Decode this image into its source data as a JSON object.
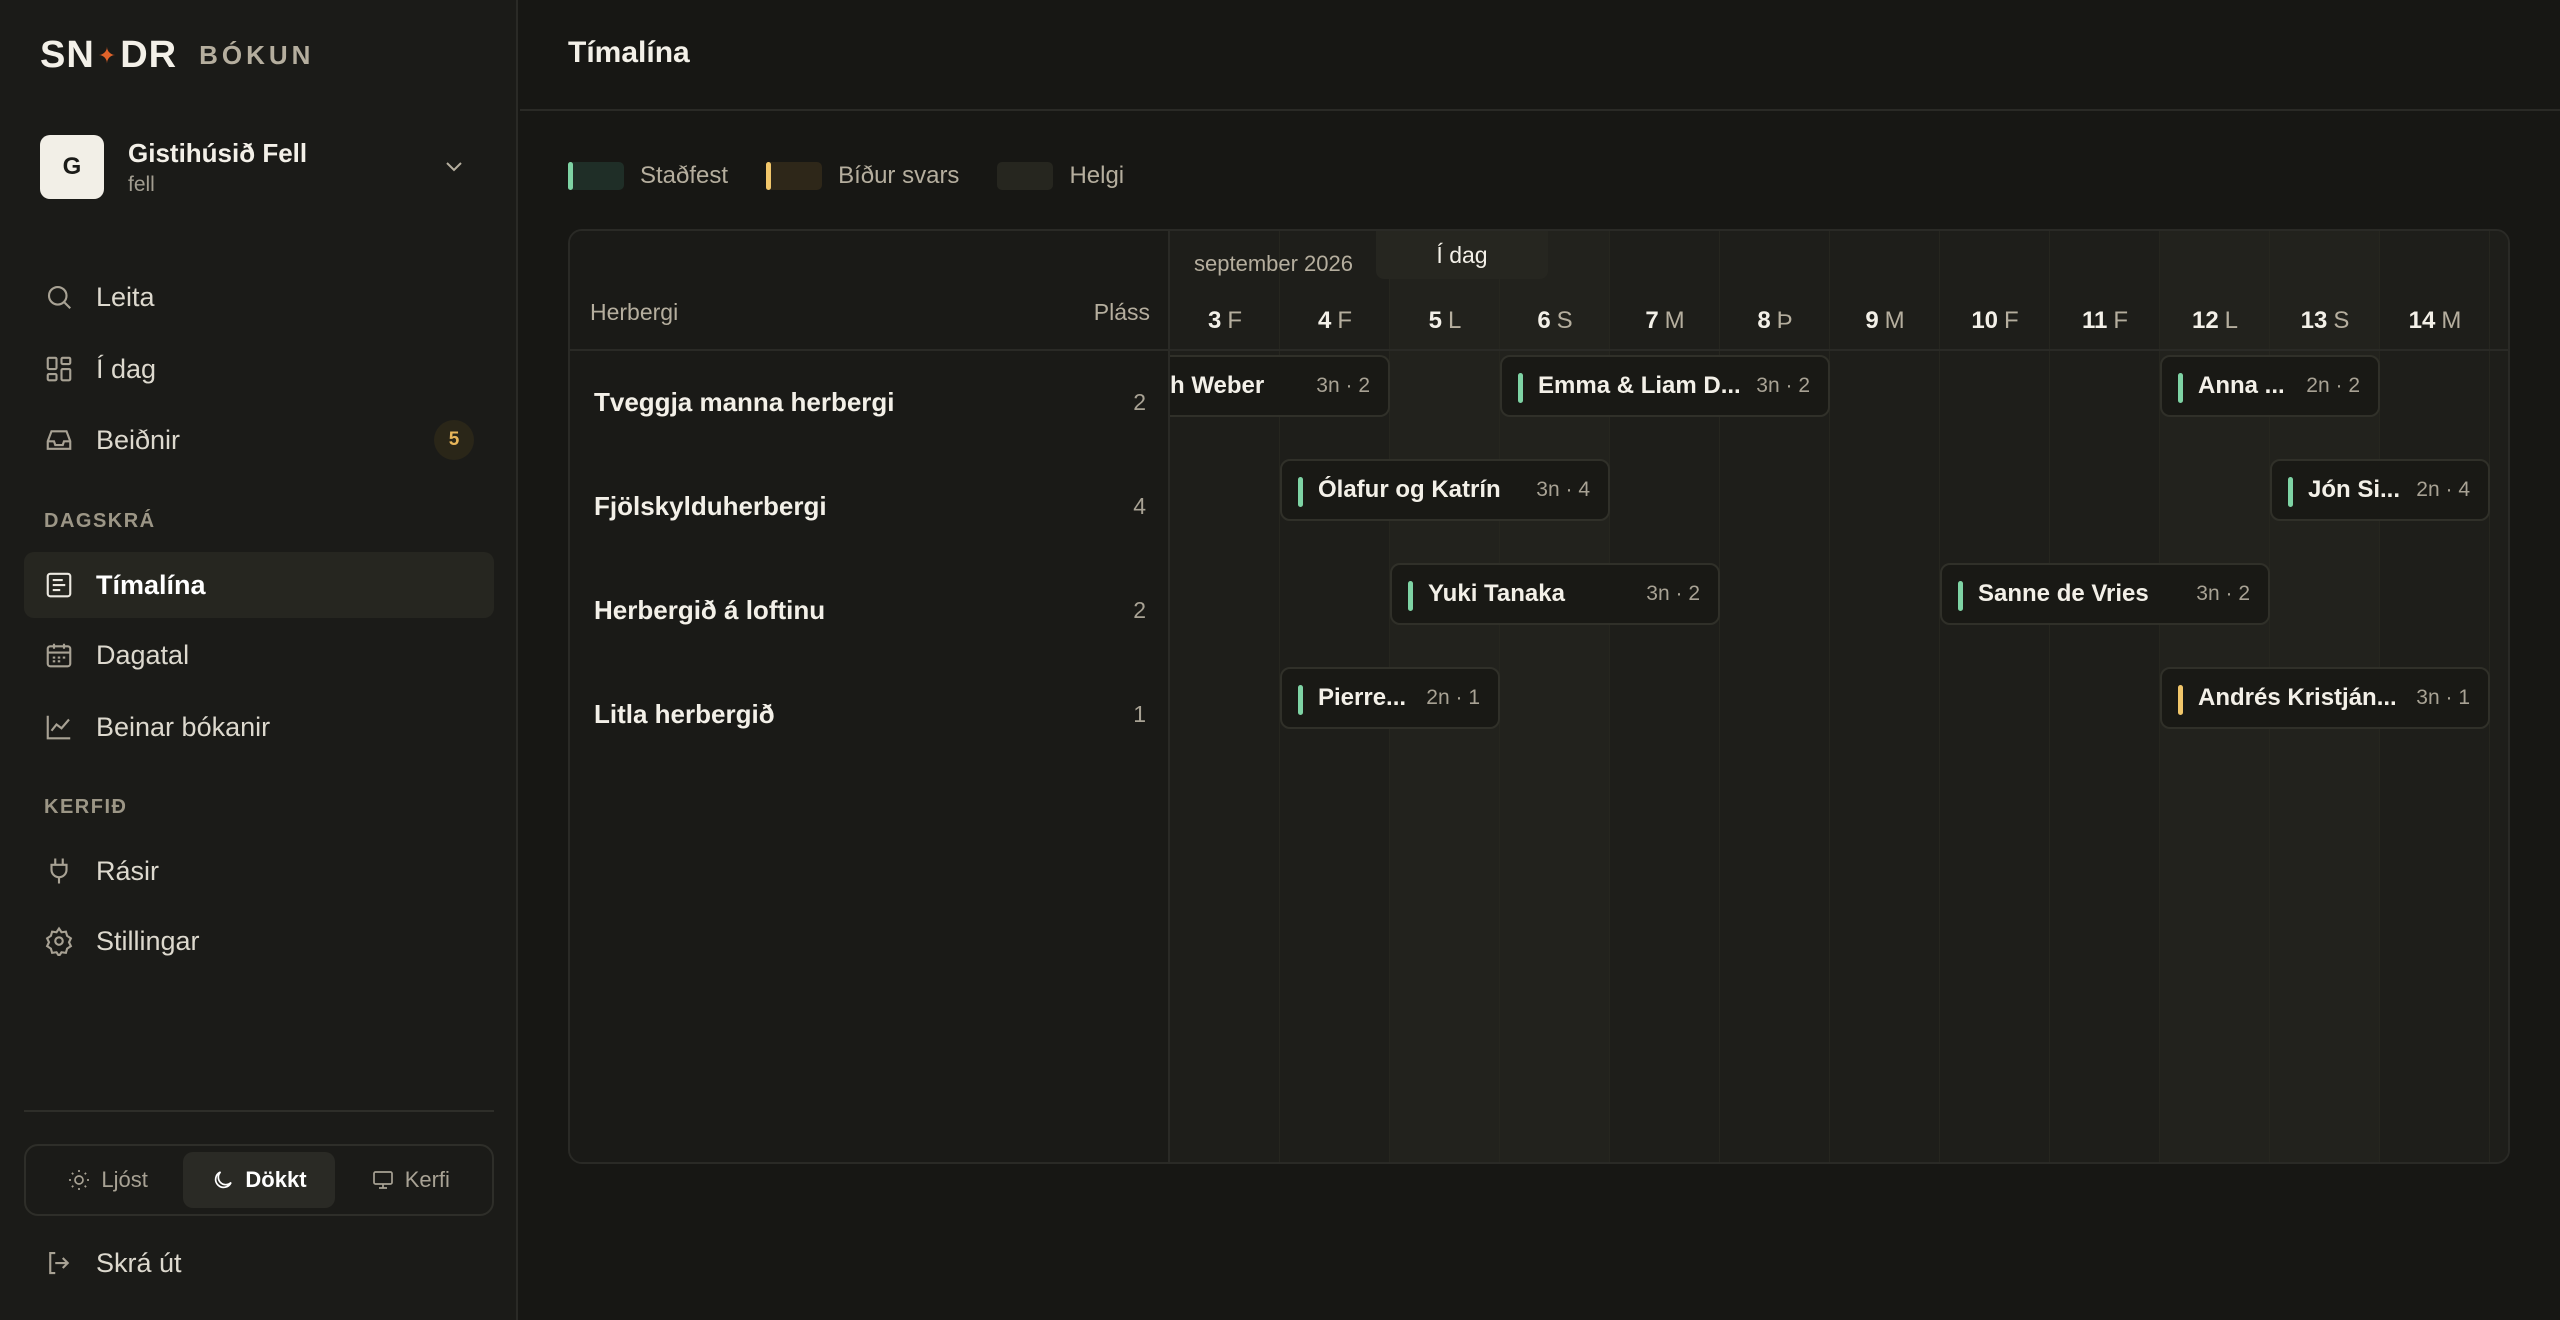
{
  "brand": {
    "mark_left": "SN",
    "mark_star": "✦",
    "mark_right": "DR",
    "product": "BÓKUN"
  },
  "property": {
    "initial": "G",
    "name": "Gistihúsið Fell",
    "slug": "fell"
  },
  "nav": {
    "search": "Leita",
    "today": "Í dag",
    "requests": "Beiðnir",
    "requests_count": "5",
    "section_schedule": "DAGSKRÁ",
    "timeline": "Tímalína",
    "calendar": "Dagatal",
    "direct_bookings": "Beinar bókanir",
    "section_system": "KERFIÐ",
    "channels": "Rásir",
    "settings": "Stillingar"
  },
  "theme": {
    "light": "Ljóst",
    "dark": "Dökkt",
    "system": "Kerfi",
    "selected": "Dökkt"
  },
  "logout": "Skrá út",
  "page": {
    "title": "Tímalína"
  },
  "legend": {
    "confirmed": "Staðfest",
    "pending": "Bíður svars",
    "weekend": "Helgi"
  },
  "timeline": {
    "month": "september 2026",
    "today_label": "Í dag",
    "col_room": "Herbergi",
    "col_capacity": "Pláss",
    "days": [
      {
        "num": "3",
        "wd": "F"
      },
      {
        "num": "4",
        "wd": "F"
      },
      {
        "num": "5",
        "wd": "L"
      },
      {
        "num": "6",
        "wd": "S"
      },
      {
        "num": "7",
        "wd": "M"
      },
      {
        "num": "8",
        "wd": "Þ"
      },
      {
        "num": "9",
        "wd": "M"
      },
      {
        "num": "10",
        "wd": "F"
      },
      {
        "num": "11",
        "wd": "F"
      },
      {
        "num": "12",
        "wd": "L"
      },
      {
        "num": "13",
        "wd": "S"
      },
      {
        "num": "14",
        "wd": "M"
      }
    ],
    "rooms": [
      {
        "name": "Tveggja manna herbergi",
        "capacity": "2"
      },
      {
        "name": "Fjölskylduherbergi",
        "capacity": "4"
      },
      {
        "name": "Herbergið á loftinu",
        "capacity": "2"
      },
      {
        "name": "Litla herbergið",
        "capacity": "1"
      }
    ],
    "bookings": [
      {
        "guest": "h Weber",
        "meta": "3n · 2",
        "status": "confirmed"
      },
      {
        "guest": "Emma & Liam D...",
        "meta": "3n · 2",
        "status": "confirmed"
      },
      {
        "guest": "Anna ...",
        "meta": "2n · 2",
        "status": "confirmed"
      },
      {
        "guest": "Ólafur og Katrín",
        "meta": "3n · 4",
        "status": "confirmed"
      },
      {
        "guest": "Jón Si...",
        "meta": "2n · 4",
        "status": "confirmed"
      },
      {
        "guest": "Yuki Tanaka",
        "meta": "3n · 2",
        "status": "confirmed"
      },
      {
        "guest": "Sanne de Vries",
        "meta": "3n · 2",
        "status": "confirmed"
      },
      {
        "guest": "Pierre...",
        "meta": "2n · 1",
        "status": "confirmed"
      },
      {
        "guest": "Andrés Kristján...",
        "meta": "3n · 1",
        "status": "pending"
      }
    ]
  },
  "colors": {
    "confirmed": "#7ed3a4",
    "pending": "#f1c66a",
    "accent_star": "#e0632a",
    "badge": "#e8b65a"
  }
}
